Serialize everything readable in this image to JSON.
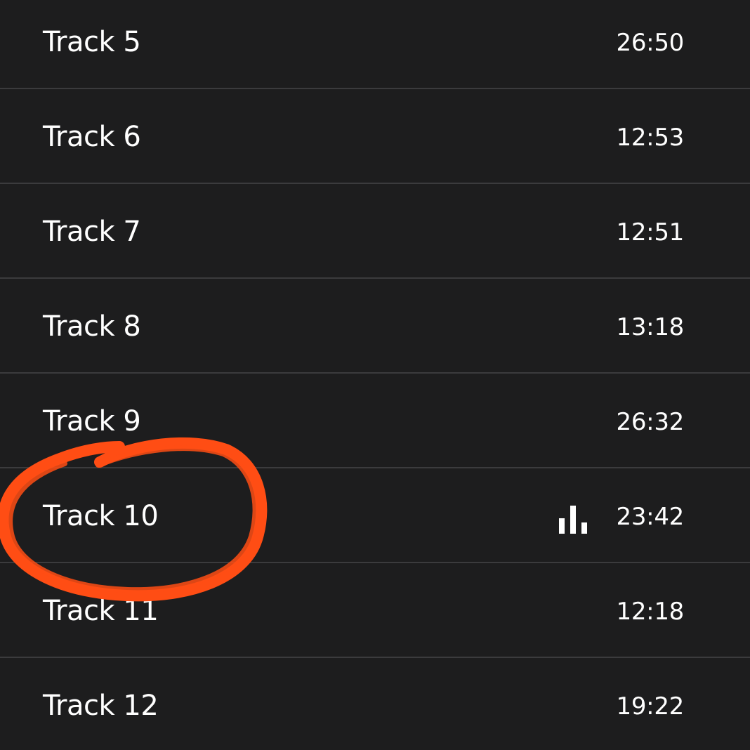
{
  "colors": {
    "background": "#1d1d1e",
    "divider": "#3b3b3d",
    "text": "#ffffff",
    "annotation": "#ff4d14"
  },
  "tracks": [
    {
      "title": "Track 5",
      "duration": "26:50"
    },
    {
      "title": "Track 6",
      "duration": "12:53"
    },
    {
      "title": "Track 7",
      "duration": "12:51"
    },
    {
      "title": "Track 8",
      "duration": "13:18"
    },
    {
      "title": "Track 9",
      "duration": "26:32"
    },
    {
      "title": "Track 10",
      "duration": "23:42",
      "now_playing": true,
      "now_playing_icon": "equalizer-bars-icon"
    },
    {
      "title": "Track 11",
      "duration": "12:18"
    },
    {
      "title": "Track 12",
      "duration": "19:22"
    }
  ],
  "annotation": {
    "type": "hand-drawn-circle",
    "target": "Track 10"
  }
}
